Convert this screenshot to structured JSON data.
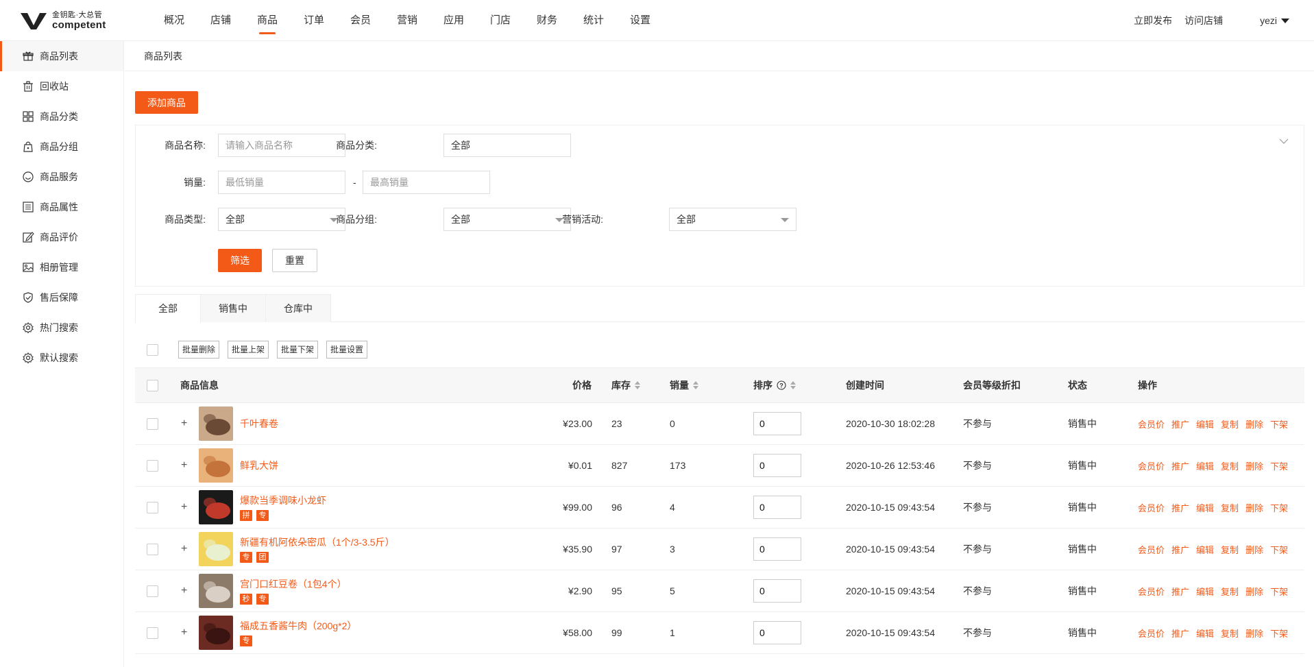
{
  "brand": {
    "line1": "金钥匙·大总管",
    "line2": "competent"
  },
  "nav": [
    {
      "label": "概况",
      "active": false
    },
    {
      "label": "店铺",
      "active": false
    },
    {
      "label": "商品",
      "active": true
    },
    {
      "label": "订单",
      "active": false
    },
    {
      "label": "会员",
      "active": false
    },
    {
      "label": "营销",
      "active": false
    },
    {
      "label": "应用",
      "active": false
    },
    {
      "label": "门店",
      "active": false
    },
    {
      "label": "财务",
      "active": false
    },
    {
      "label": "统计",
      "active": false
    },
    {
      "label": "设置",
      "active": false
    }
  ],
  "top_right": {
    "publish": "立即发布",
    "visit": "访问店铺",
    "user": "yezi"
  },
  "sidebar": [
    {
      "label": "商品列表",
      "icon": "gift-icon"
    },
    {
      "label": "回收站",
      "icon": "trash-icon"
    },
    {
      "label": "商品分类",
      "icon": "grid-icon"
    },
    {
      "label": "商品分组",
      "icon": "bag-icon"
    },
    {
      "label": "商品服务",
      "icon": "smile-icon"
    },
    {
      "label": "商品属性",
      "icon": "list-icon"
    },
    {
      "label": "商品评价",
      "icon": "edit-icon"
    },
    {
      "label": "相册管理",
      "icon": "image-icon"
    },
    {
      "label": "售后保障",
      "icon": "shield-icon"
    },
    {
      "label": "热门搜索",
      "icon": "gear-icon"
    },
    {
      "label": "默认搜索",
      "icon": "gear-icon"
    }
  ],
  "breadcrumb": "商品列表",
  "add_button": "添加商品",
  "filter": {
    "name_label": "商品名称:",
    "name_placeholder": "请输入商品名称",
    "category_label": "商品分类:",
    "category_value": "全部",
    "sales_label": "销量:",
    "sales_min_placeholder": "最低销量",
    "sales_dash": "-",
    "sales_max_placeholder": "最高销量",
    "type_label": "商品类型:",
    "type_value": "全部",
    "group_label": "商品分组:",
    "group_value": "全部",
    "promo_label": "营销活动:",
    "promo_value": "全部",
    "submit": "筛选",
    "reset": "重置"
  },
  "tabs": [
    {
      "label": "全部",
      "active": true
    },
    {
      "label": "销售中",
      "active": false
    },
    {
      "label": "仓库中",
      "active": false
    }
  ],
  "batch": [
    "批量删除",
    "批量上架",
    "批量下架",
    "批量设置"
  ],
  "table": {
    "headers": {
      "info": "商品信息",
      "price": "价格",
      "stock": "库存",
      "sales": "销量",
      "order": "排序",
      "created": "创建时间",
      "discount": "会员等级折扣",
      "status": "状态",
      "ops": "操作"
    },
    "ops": [
      "会员价",
      "推广",
      "编辑",
      "复制",
      "删除",
      "下架"
    ],
    "rows": [
      {
        "name": "千叶春卷",
        "tags": [],
        "price": "¥23.00",
        "stock": "23",
        "sales": "0",
        "order": "0",
        "created": "2020-10-30 18:02:28",
        "discount": "不参与",
        "status": "销售中",
        "thumb": [
          "#c9a98a",
          "#6b4a35"
        ]
      },
      {
        "name": "鲜乳大饼",
        "tags": [],
        "price": "¥0.01",
        "stock": "827",
        "sales": "173",
        "order": "0",
        "created": "2020-10-26 12:53:46",
        "discount": "不参与",
        "status": "销售中",
        "thumb": [
          "#e8b27a",
          "#c4743a"
        ]
      },
      {
        "name": "爆款当季调味小龙虾",
        "tags": [
          "拼",
          "专"
        ],
        "price": "¥99.00",
        "stock": "96",
        "sales": "4",
        "order": "0",
        "created": "2020-10-15 09:43:54",
        "discount": "不参与",
        "status": "销售中",
        "thumb": [
          "#1a1a1a",
          "#c0392b"
        ]
      },
      {
        "name": "新疆有机阿依朵密瓜（1个/3-3.5斤）",
        "tags": [
          "专",
          "团"
        ],
        "price": "¥35.90",
        "stock": "97",
        "sales": "3",
        "order": "0",
        "created": "2020-10-15 09:43:54",
        "discount": "不参与",
        "status": "销售中",
        "thumb": [
          "#f2d45c",
          "#e8f0d0"
        ]
      },
      {
        "name": "宫门口红豆卷（1包4个）",
        "tags": [
          "秒",
          "专"
        ],
        "price": "¥2.90",
        "stock": "95",
        "sales": "5",
        "order": "0",
        "created": "2020-10-15 09:43:54",
        "discount": "不参与",
        "status": "销售中",
        "thumb": [
          "#8d7b6a",
          "#d9cfc4"
        ]
      },
      {
        "name": "福成五香酱牛肉（200g*2）",
        "tags": [
          "专"
        ],
        "price": "¥58.00",
        "stock": "99",
        "sales": "1",
        "order": "0",
        "created": "2020-10-15 09:43:54",
        "discount": "不参与",
        "status": "销售中",
        "thumb": [
          "#6b2a22",
          "#3a1410"
        ]
      }
    ]
  },
  "colors": {
    "accent": "#f35a17",
    "border": "#eeeeee",
    "header_bg": "#f7f7f7"
  }
}
